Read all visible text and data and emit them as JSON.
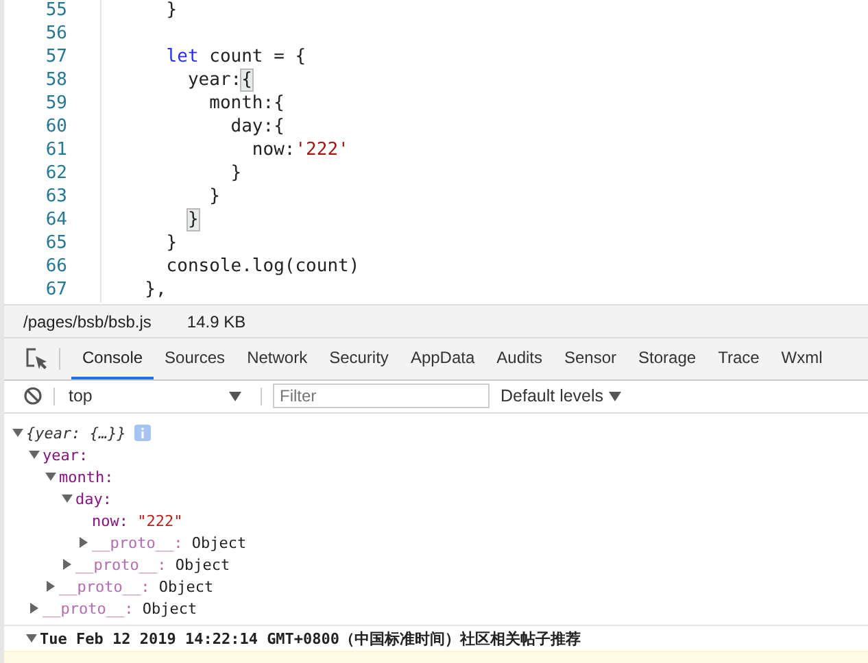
{
  "editor": {
    "lines": [
      {
        "number": "55",
        "tokens": [
          {
            "text": "    }",
            "kind": "punct"
          }
        ]
      },
      {
        "number": "56"
      },
      {
        "number": "57",
        "tokens": [
          {
            "text": "    let",
            "kind": "keyword"
          },
          {
            "text": " count = {",
            "kind": "plain"
          }
        ]
      },
      {
        "number": "58",
        "tokens": [
          {
            "text": "      year:",
            "kind": "plain"
          },
          {
            "text": "{",
            "kind": "match"
          }
        ]
      },
      {
        "number": "59",
        "tokens": [
          {
            "text": "        month:{",
            "kind": "plain"
          }
        ]
      },
      {
        "number": "60",
        "tokens": [
          {
            "text": "          day:{",
            "kind": "plain"
          }
        ]
      },
      {
        "number": "61",
        "tokens": [
          {
            "text": "            now:",
            "kind": "plain"
          },
          {
            "text": "'222'",
            "kind": "string"
          }
        ]
      },
      {
        "number": "62",
        "tokens": [
          {
            "text": "          }",
            "kind": "plain"
          }
        ]
      },
      {
        "number": "63",
        "tokens": [
          {
            "text": "        }",
            "kind": "plain"
          }
        ]
      },
      {
        "number": "64",
        "tokens": [
          {
            "text": "      }",
            "kind": "match"
          }
        ]
      },
      {
        "number": "65",
        "tokens": [
          {
            "text": "    }",
            "kind": "plain"
          }
        ]
      },
      {
        "number": "66",
        "tokens": [
          {
            "text": "    console.log(count)",
            "kind": "plain"
          }
        ]
      },
      {
        "number": "67",
        "tokens": [
          {
            "text": "  },",
            "kind": "plain"
          }
        ]
      }
    ]
  },
  "file_bar": {
    "path": "/pages/bsb/bsb.js",
    "size": "14.9 KB"
  },
  "tabs": [
    {
      "label": "Console",
      "selected": true
    },
    {
      "label": "Sources",
      "selected": false
    },
    {
      "label": "Network",
      "selected": false
    },
    {
      "label": "Security",
      "selected": false
    },
    {
      "label": "AppData",
      "selected": false
    },
    {
      "label": "Audits",
      "selected": false
    },
    {
      "label": "Sensor",
      "selected": false
    },
    {
      "label": "Storage",
      "selected": false
    },
    {
      "label": "Trace",
      "selected": false
    },
    {
      "label": "Wxml",
      "selected": false
    }
  ],
  "console_toolbar": {
    "context": "top",
    "filter_placeholder": "Filter",
    "levels": "Default levels"
  },
  "console_output": {
    "object": {
      "summary": "{year: {…}}",
      "expanded": true,
      "children": [
        {
          "key": "year:",
          "kind": "object",
          "expanded": true,
          "children": [
            {
              "key": "month:",
              "kind": "object",
              "expanded": true,
              "children": [
                {
                  "key": "day:",
                  "kind": "object",
                  "expanded": true,
                  "children": [
                    {
                      "key": "now:",
                      "value": "\"222\"",
                      "kind": "string"
                    },
                    {
                      "key": "__proto__:",
                      "value": "Object",
                      "kind": "proto",
                      "expanded": false
                    }
                  ]
                },
                {
                  "key": "__proto__:",
                  "value": "Object",
                  "kind": "proto",
                  "expanded": false
                }
              ]
            },
            {
              "key": "__proto__:",
              "value": "Object",
              "kind": "proto",
              "expanded": false
            }
          ]
        },
        {
          "key": "__proto__:",
          "value": "Object",
          "kind": "proto",
          "expanded": false
        }
      ]
    },
    "group": {
      "text": "Tue Feb 12 2019 14:22:14 GMT+0800（中国标准时间）社区相关帖子推荐",
      "expanded": true
    }
  }
}
